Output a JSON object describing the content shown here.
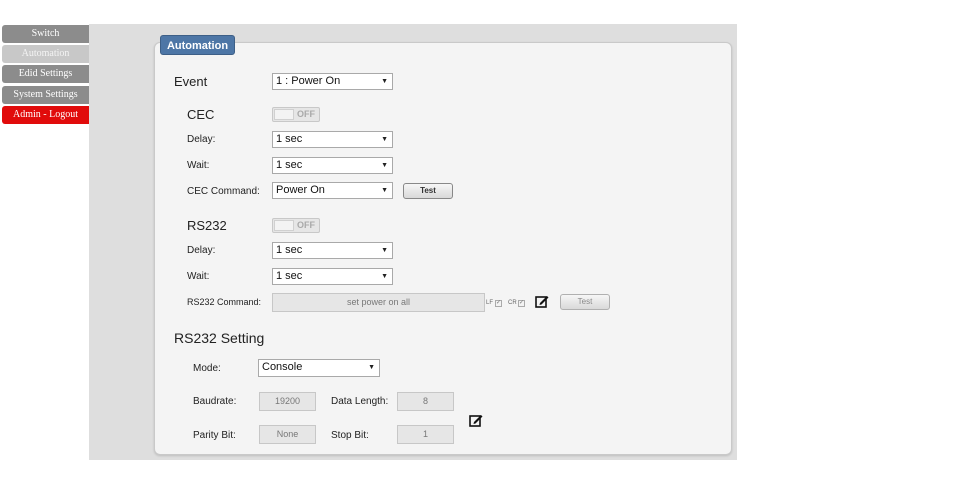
{
  "sidebar": {
    "items": [
      {
        "label": "Switch"
      },
      {
        "label": "Automation"
      },
      {
        "label": "Edid Settings"
      },
      {
        "label": "System Settings"
      },
      {
        "label": "Admin - Logout"
      }
    ]
  },
  "panel": {
    "title": "Automation",
    "event": {
      "label": "Event",
      "value": "1 : Power On"
    },
    "cec": {
      "label": "CEC",
      "toggle": "OFF",
      "delay_label": "Delay:",
      "delay_value": "1 sec",
      "wait_label": "Wait:",
      "wait_value": "1 sec",
      "command_label": "CEC Command:",
      "command_value": "Power On",
      "test_label": "Test"
    },
    "rs232": {
      "label": "RS232",
      "toggle": "OFF",
      "delay_label": "Delay:",
      "delay_value": "1 sec",
      "wait_label": "Wait:",
      "wait_value": "1 sec",
      "command_label": "RS232 Command:",
      "command_value": "set power on all",
      "lf_label": "LF",
      "cr_label": "CR",
      "test_label": "Test"
    },
    "rs232_setting": {
      "title": "RS232 Setting",
      "mode_label": "Mode:",
      "mode_value": "Console",
      "baudrate_label": "Baudrate:",
      "baudrate_value": "19200",
      "data_length_label": "Data Length:",
      "data_length_value": "8",
      "parity_label": "Parity Bit:",
      "parity_value": "None",
      "stop_bit_label": "Stop Bit:",
      "stop_bit_value": "1"
    }
  },
  "icons": {
    "edit": "edit-icon",
    "dropdown": "chevron-down-icon",
    "check": "checkmark-icon"
  },
  "colors": {
    "tab_blue": "#4d76a6",
    "logout_red": "#e10b0b",
    "nav_grey": "#8c8c8c"
  }
}
